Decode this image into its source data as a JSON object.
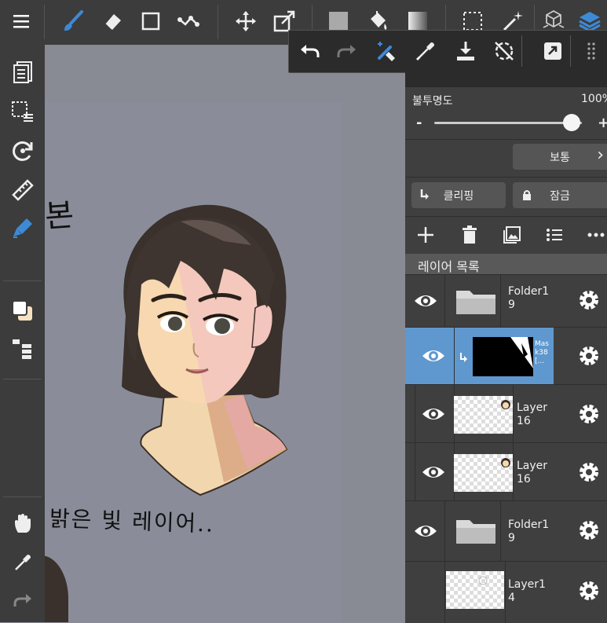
{
  "opacity": {
    "label": "불투명도",
    "value": "100%",
    "minus": "-",
    "plus": "+",
    "fraction": 0.93
  },
  "blend": {
    "mode": "보통",
    "chevron": "›"
  },
  "buttons": {
    "clipping": "클리핑",
    "lock": "잠금"
  },
  "layer_list": {
    "title": "레이어 목록"
  },
  "layers": [
    {
      "name_line1": "Folder1",
      "name_line2": "9",
      "type": "folder",
      "visible": true
    },
    {
      "name_line1": "Mas",
      "name_line2": "k38",
      "name_line3": "[...",
      "type": "mask",
      "visible": true,
      "selected": true,
      "clipped": true
    },
    {
      "name_line1": "Layer",
      "name_line2": "16",
      "type": "layer",
      "visible": true
    },
    {
      "name_line1": "Layer",
      "name_line2": "16",
      "type": "layer",
      "visible": true
    },
    {
      "name_line1": "Folder1",
      "name_line2": "9",
      "type": "folder",
      "visible": true
    },
    {
      "name_line1": "Layer1",
      "name_line2": "4",
      "type": "layer",
      "visible": false
    }
  ],
  "canvas": {
    "handwriting_top": "본",
    "handwriting_bottom": "밝은 빛 레이어.."
  },
  "colors": {
    "accent": "#5f98cf",
    "brush_blue": "#3d8ad6",
    "panel": "#3f3f3f",
    "toolbar": "#3c3c3c"
  },
  "icons": {
    "top": [
      "menu-icon",
      "brush-icon",
      "eraser-icon",
      "rectangle-icon",
      "line-icon",
      "move-icon",
      "transform-icon",
      "fill-color-icon",
      "bucket-icon",
      "gradient-icon",
      "selection-icon",
      "magic-wand-icon",
      "3d-icon",
      "layers-icon"
    ],
    "left": [
      "pages-icon",
      "select-menu-icon",
      "rotate-icon",
      "ruler-icon",
      "pen-fill-icon",
      "color-swatch-icon",
      "layer-list-icon",
      "hand-icon",
      "eyedropper-icon",
      "redo-icon"
    ],
    "sub": [
      "undo-icon",
      "redo-icon",
      "eraser-brush-icon",
      "eyedropper-icon",
      "save-icon",
      "rotate-reset-icon",
      "export-icon",
      "grid-handle-icon"
    ]
  }
}
